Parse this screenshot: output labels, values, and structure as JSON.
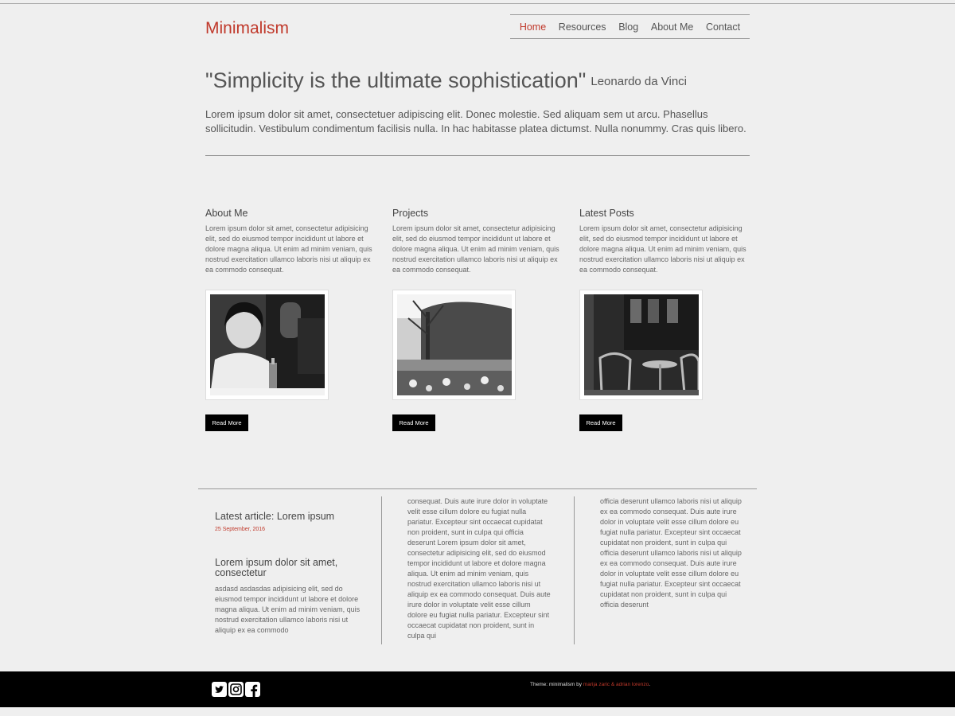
{
  "header": {
    "brand": "Minimalism",
    "nav": [
      "Home",
      "Resources",
      "Blog",
      "About Me",
      "Contact"
    ],
    "active_nav": "Home"
  },
  "hero": {
    "quote": "\"Simplicity is the ultimate sophistication\"",
    "author": "Leonardo da Vinci",
    "intro": "Lorem ipsum dolor sit amet, consectetuer adipiscing elit. Donec molestie. Sed aliquam sem ut arcu. Phasellus sollicitudin. Vestibulum condimentum facilisis nulla. In hac habitasse platea dictumst. Nulla nonummy. Cras quis libero."
  },
  "columns": [
    {
      "title": "About Me",
      "text": "Lorem ipsum dolor sit amet, consectetur adipisicing elit, sed do eiusmod tempor incididunt ut labore et dolore magna aliqua. Ut enim ad minim veniam, quis nostrud exercitation ullamco laboris nisi ut aliquip ex ea commodo consequat.",
      "button": "Read More"
    },
    {
      "title": "Projects",
      "text": "Lorem ipsum dolor sit amet, consectetur adipisicing elit, sed do eiusmod tempor incididunt ut labore et dolore magna aliqua. Ut enim ad minim veniam, quis nostrud exercitation ullamco laboris nisi ut aliquip ex ea commodo consequat.",
      "button": "Read More"
    },
    {
      "title": "Latest Posts",
      "text": "Lorem ipsum dolor sit amet, consectetur adipisicing elit, sed do eiusmod tempor incididunt ut labore et dolore magna aliqua. Ut enim ad minim veniam, quis nostrud exercitation ullamco laboris nisi ut aliquip ex ea commodo consequat.",
      "button": "Read More"
    }
  ],
  "lower": {
    "latest_title": "Latest article: Lorem ipsum",
    "latest_date": "25 September, 2016",
    "article_title": "Lorem ipsum dolor sit amet, consectetur",
    "article_body": "asdasd asdasdas adipisicing elit, sed do eiusmod tempor incididunt ut labore et dolore magna aliqua. Ut enim ad minim veniam, quis nostrud exercitation ullamco laboris nisi ut aliquip ex ea commodo",
    "middle_text": "consequat. Duis aute irure dolor in voluptate velit esse cillum dolore eu fugiat nulla pariatur. Excepteur sint occaecat cupidatat non proident, sunt in culpa qui officia deserunt Lorem ipsum dolor sit amet, consectetur adipisicing elit, sed do eiusmod tempor incididunt ut labore et dolore magna aliqua. Ut enim ad minim veniam, quis nostrud exercitation ullamco laboris nisi ut aliquip ex ea commodo consequat. Duis aute irure dolor in voluptate velit esse cillum dolore eu fugiat nulla pariatur. Excepteur sint occaecat cupidatat non proident, sunt in culpa qui",
    "right_text": "officia deserunt ullamco laboris nisi ut aliquip ex ea commodo consequat. Duis aute irure dolor in voluptate velit esse cillum dolore eu fugiat nulla pariatur. Excepteur sint occaecat cupidatat non proident, sunt in culpa qui officia deserunt ullamco laboris nisi ut aliquip ex ea commodo consequat. Duis aute irure dolor in voluptate velit esse cillum dolore eu fugiat nulla pariatur. Excepteur sint occaecat cupidatat non proident, sunt in culpa qui officia deserunt"
  },
  "footer": {
    "social_icons": [
      "twitter-icon",
      "instagram-icon",
      "facebook-icon"
    ],
    "credit_prefix": "Theme: minimalism by",
    "credit_authors": "marija zaric & adrian lorenzo",
    "credit_suffix": "."
  },
  "colors": {
    "accent": "#c0392b",
    "background": "#efefef",
    "footer": "#000000"
  }
}
